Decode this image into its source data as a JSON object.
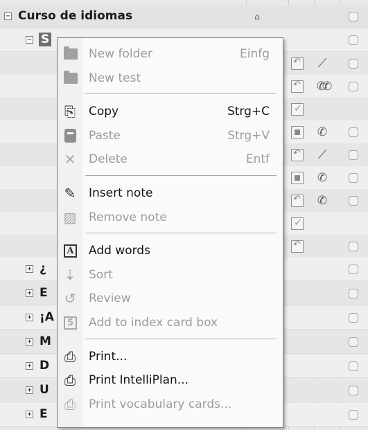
{
  "tree": {
    "root_label": "Curso de idiomas",
    "root_expander": "−",
    "selected_label": "S",
    "selected_expander": "−",
    "collapsed_items": [
      {
        "label": "¿",
        "expander": "+"
      },
      {
        "label": "E",
        "expander": "+"
      },
      {
        "label": "¡A",
        "expander": "+"
      },
      {
        "label": "M",
        "expander": "+"
      },
      {
        "label": "D",
        "expander": "+"
      },
      {
        "label": "U",
        "expander": "+"
      },
      {
        "label": "E",
        "expander": "+"
      }
    ],
    "row_icons": [
      [
        "import-icon",
        "microphone-icon"
      ],
      [
        "import-icon",
        "ears-icon"
      ],
      [
        "check-icon"
      ],
      [
        "gray-box-icon",
        "ear-icon"
      ],
      [
        "import-icon",
        "microphone-icon"
      ],
      [
        "gray-box-icon",
        "ear-icon"
      ],
      [
        "import-icon",
        "ear-icon"
      ],
      [
        "check-icon"
      ],
      [
        "import-icon"
      ]
    ]
  },
  "context_menu": {
    "items": [
      {
        "label": "New folder",
        "shortcut": "Einfg",
        "enabled": false,
        "icon": "folder-icon"
      },
      {
        "label": "New test",
        "shortcut": "",
        "enabled": false,
        "icon": "folder-icon"
      },
      {
        "separator": true
      },
      {
        "label": "Copy",
        "shortcut": "Strg+C",
        "enabled": true,
        "icon": "copy-icon"
      },
      {
        "label": "Paste",
        "shortcut": "Strg+V",
        "enabled": false,
        "icon": "paste-icon"
      },
      {
        "label": "Delete",
        "shortcut": "Entf",
        "enabled": false,
        "icon": "delete-icon"
      },
      {
        "separator": true
      },
      {
        "label": "Insert note",
        "shortcut": "",
        "enabled": true,
        "icon": "note-icon"
      },
      {
        "label": "Remove note",
        "shortcut": "",
        "enabled": false,
        "icon": "remove-note-icon"
      },
      {
        "separator": true
      },
      {
        "label": "Add words",
        "shortcut": "",
        "enabled": true,
        "icon": "add-words-icon"
      },
      {
        "label": "Sort",
        "shortcut": "",
        "enabled": false,
        "icon": "sort-icon"
      },
      {
        "label": "Review",
        "shortcut": "",
        "enabled": false,
        "icon": "review-icon"
      },
      {
        "label": "Add to index card box",
        "shortcut": "",
        "enabled": false,
        "icon": "index-card-box-icon"
      },
      {
        "separator": true
      },
      {
        "label": "Print...",
        "shortcut": "",
        "enabled": true,
        "icon": "printer-icon"
      },
      {
        "label": "Print IntelliPlan...",
        "shortcut": "",
        "enabled": true,
        "icon": "printer-icon"
      },
      {
        "label": "Print vocabulary cards...",
        "shortcut": "",
        "enabled": false,
        "icon": "printer-icon"
      }
    ]
  }
}
